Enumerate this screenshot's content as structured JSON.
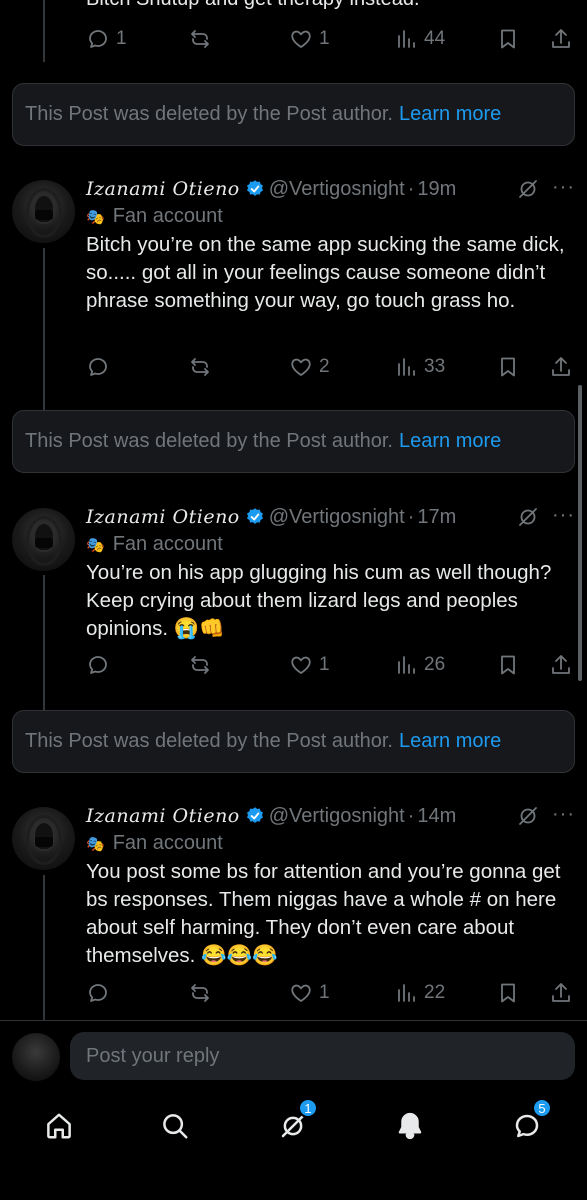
{
  "top_post": {
    "text_cut": "Bitch Shutup and get therapy instead.",
    "stats": {
      "replies": "1",
      "reposts": "",
      "likes": "1",
      "views": "44"
    }
  },
  "deleted_notice": {
    "text": "This Post was deleted by the Post author.",
    "link": "Learn more"
  },
  "author": {
    "display_name": "Izanami Otieno",
    "handle": "@Vertigosnight",
    "label": "Fan account",
    "label_icon": "mask-icon"
  },
  "posts": [
    {
      "time": "19m",
      "text": "Bitch you’re on the same app sucking the same dick, so..... got all in your feelings cause someone didn’t phrase something your way, go touch grass ho.",
      "stats": {
        "replies": "",
        "reposts": "",
        "likes": "2",
        "views": "33"
      }
    },
    {
      "time": "17m",
      "text": "You’re on his app glugging his cum as well though? Keep crying about them lizard legs and peoples opinions. 😭👊",
      "stats": {
        "replies": "",
        "reposts": "",
        "likes": "1",
        "views": "26"
      }
    },
    {
      "time": "14m",
      "text": "You post some bs for attention and you’re gonna get bs responses. Them niggas have a whole # on here about self harming. They don’t even care about themselves. 😂😂😂",
      "stats": {
        "replies": "",
        "reposts": "",
        "likes": "1",
        "views": "22"
      }
    }
  ],
  "reply_box": {
    "placeholder": "Post your reply"
  },
  "nav": {
    "items": [
      "home-icon",
      "search-icon",
      "grok-icon",
      "notifications-icon",
      "messages-icon"
    ],
    "grok_badge": "1",
    "messages_badge": "5"
  },
  "colors": {
    "background": "#000000",
    "accent": "#1d9bf0",
    "muted": "#71767b",
    "text": "#e7e9ea"
  }
}
